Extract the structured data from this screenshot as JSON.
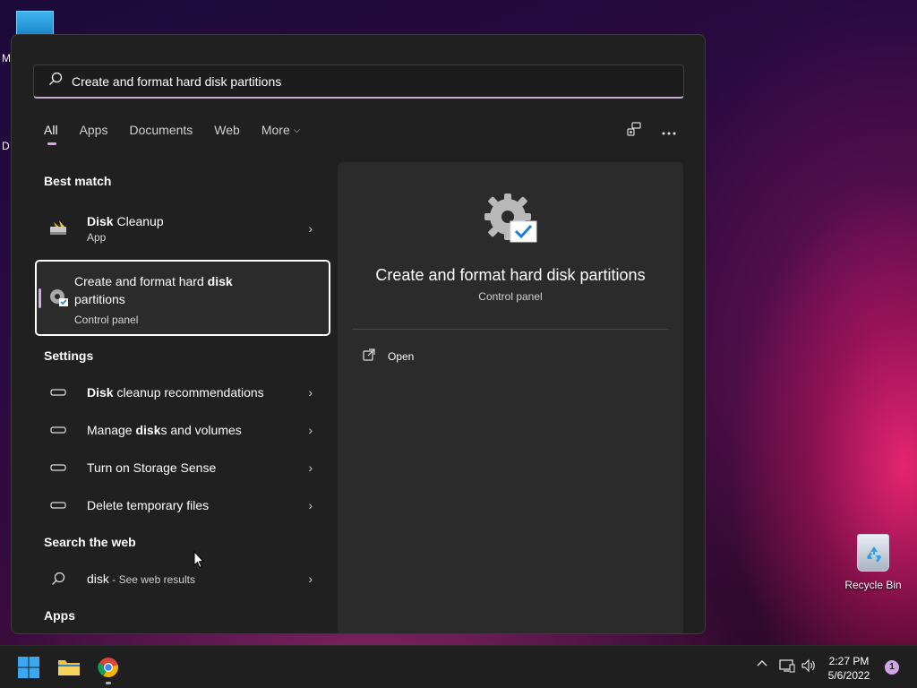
{
  "desktop": {
    "partial_label_1": "M",
    "partial_label_2": "D",
    "recycle_bin_label": "Recycle Bin"
  },
  "search": {
    "value": "Create and format hard disk partitions",
    "icon": "search-icon"
  },
  "tabs": [
    {
      "label": "All",
      "active": true
    },
    {
      "label": "Apps"
    },
    {
      "label": "Documents"
    },
    {
      "label": "Web"
    },
    {
      "label": "More"
    }
  ],
  "sections": {
    "best_match": "Best match",
    "settings": "Settings",
    "search_web": "Search the web",
    "apps": "Apps"
  },
  "best_match": [
    {
      "title_bold": "Disk",
      "title_rest": " Cleanup",
      "subtitle": "App"
    },
    {
      "title_pre": "Create and format hard ",
      "title_bold": "disk",
      "title_rest": "partitions",
      "subtitle": "Control panel",
      "selected": true
    }
  ],
  "settings": [
    {
      "bold": "Disk",
      "rest": " cleanup recommendations"
    },
    {
      "pre": "Manage ",
      "bold": "disk",
      "rest": "s and volumes"
    },
    {
      "text": "Turn on Storage Sense"
    },
    {
      "text": "Delete temporary files"
    }
  ],
  "web": {
    "query": "disk",
    "suffix": " - See web results"
  },
  "detail": {
    "title": "Create and format hard disk partitions",
    "subtitle": "Control panel",
    "open_label": "Open"
  },
  "taskbar": {
    "time": "2:27 PM",
    "date": "5/6/2022",
    "notification_count": "1"
  },
  "colors": {
    "accent": "#d9a7e6",
    "panel_bg": "#202020",
    "pane_bg": "#2b2b2b"
  }
}
